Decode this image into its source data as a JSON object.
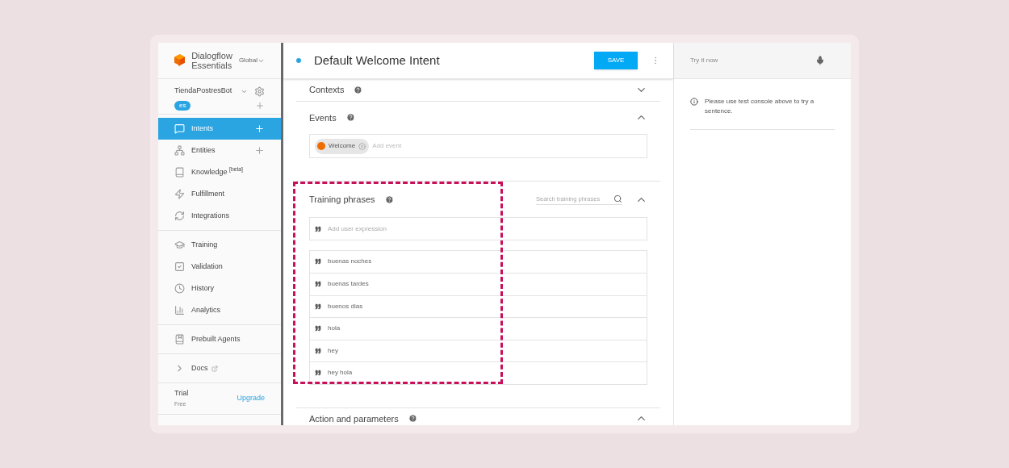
{
  "sidebar": {
    "brand": [
      "Dialogflow",
      "Essentials"
    ],
    "region": "Global",
    "agent": "TiendaPostresBot",
    "language": "es",
    "sections": [
      [
        {
          "label": "Intents",
          "selected": true,
          "addable": true
        },
        {
          "label": "Entities",
          "selected": false,
          "addable": true
        },
        {
          "label": "Knowledge $^{[beta]}$",
          "selected": false,
          "addable": false
        },
        {
          "label": "Fulfillment",
          "selected": false,
          "addable": false
        },
        {
          "label": "Integrations",
          "selected": false,
          "addable": false
        }
      ],
      [
        {
          "label": "Training",
          "selected": false,
          "addable": false
        },
        {
          "label": "Validation",
          "selected": false,
          "addable": false
        },
        {
          "label": "History",
          "selected": false,
          "addable": false
        },
        {
          "label": "Analytics",
          "selected": false,
          "addable": false
        }
      ],
      [
        {
          "label": "Prebuilt Agents",
          "selected": false,
          "addable": false
        }
      ],
      [
        {
          "label": "Docs",
          "selected": false,
          "addable": false
        }
      ]
    ],
    "plan": {
      "name": "Trial",
      "tier": "Free",
      "action": "Upgrade"
    }
  },
  "header": {
    "title": "Default Welcome Intent",
    "save": "SAVE"
  },
  "sections": [
    {
      "kind": "contexts",
      "title": "Contexts",
      "expanded": false
    },
    {
      "kind": "events",
      "title": "Events",
      "expanded": true,
      "events": [
        {
          "label": "Welcome"
        }
      ],
      "placeholder": "Add event"
    },
    {
      "kind": "training",
      "title": "Training phrases",
      "expanded": true,
      "search_placeholder": "Search training phrases",
      "add_placeholder": "Add user expression",
      "phrases": [
        "buenas noches",
        "buenas tardes",
        "buenos dias",
        "hola",
        "hey",
        "hey hola"
      ]
    },
    {
      "kind": "action",
      "title": "Action and parameters",
      "expanded": true
    }
  ],
  "test_console": {
    "placeholder": "Try it now",
    "message": "Please use test console above to try a sentence."
  }
}
